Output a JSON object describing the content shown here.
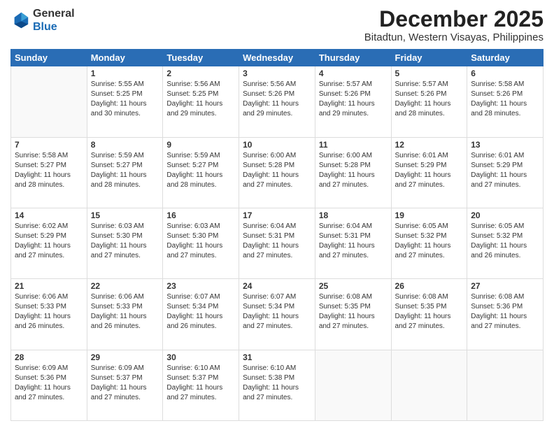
{
  "header": {
    "logo_line1": "General",
    "logo_line2": "Blue",
    "month": "December 2025",
    "location": "Bitadtun, Western Visayas, Philippines"
  },
  "days_of_week": [
    "Sunday",
    "Monday",
    "Tuesday",
    "Wednesday",
    "Thursday",
    "Friday",
    "Saturday"
  ],
  "weeks": [
    [
      {
        "day": "",
        "info": ""
      },
      {
        "day": "1",
        "info": "Sunrise: 5:55 AM\nSunset: 5:25 PM\nDaylight: 11 hours\nand 30 minutes."
      },
      {
        "day": "2",
        "info": "Sunrise: 5:56 AM\nSunset: 5:25 PM\nDaylight: 11 hours\nand 29 minutes."
      },
      {
        "day": "3",
        "info": "Sunrise: 5:56 AM\nSunset: 5:26 PM\nDaylight: 11 hours\nand 29 minutes."
      },
      {
        "day": "4",
        "info": "Sunrise: 5:57 AM\nSunset: 5:26 PM\nDaylight: 11 hours\nand 29 minutes."
      },
      {
        "day": "5",
        "info": "Sunrise: 5:57 AM\nSunset: 5:26 PM\nDaylight: 11 hours\nand 28 minutes."
      },
      {
        "day": "6",
        "info": "Sunrise: 5:58 AM\nSunset: 5:26 PM\nDaylight: 11 hours\nand 28 minutes."
      }
    ],
    [
      {
        "day": "7",
        "info": "Sunrise: 5:58 AM\nSunset: 5:27 PM\nDaylight: 11 hours\nand 28 minutes."
      },
      {
        "day": "8",
        "info": "Sunrise: 5:59 AM\nSunset: 5:27 PM\nDaylight: 11 hours\nand 28 minutes."
      },
      {
        "day": "9",
        "info": "Sunrise: 5:59 AM\nSunset: 5:27 PM\nDaylight: 11 hours\nand 28 minutes."
      },
      {
        "day": "10",
        "info": "Sunrise: 6:00 AM\nSunset: 5:28 PM\nDaylight: 11 hours\nand 27 minutes."
      },
      {
        "day": "11",
        "info": "Sunrise: 6:00 AM\nSunset: 5:28 PM\nDaylight: 11 hours\nand 27 minutes."
      },
      {
        "day": "12",
        "info": "Sunrise: 6:01 AM\nSunset: 5:29 PM\nDaylight: 11 hours\nand 27 minutes."
      },
      {
        "day": "13",
        "info": "Sunrise: 6:01 AM\nSunset: 5:29 PM\nDaylight: 11 hours\nand 27 minutes."
      }
    ],
    [
      {
        "day": "14",
        "info": "Sunrise: 6:02 AM\nSunset: 5:29 PM\nDaylight: 11 hours\nand 27 minutes."
      },
      {
        "day": "15",
        "info": "Sunrise: 6:03 AM\nSunset: 5:30 PM\nDaylight: 11 hours\nand 27 minutes."
      },
      {
        "day": "16",
        "info": "Sunrise: 6:03 AM\nSunset: 5:30 PM\nDaylight: 11 hours\nand 27 minutes."
      },
      {
        "day": "17",
        "info": "Sunrise: 6:04 AM\nSunset: 5:31 PM\nDaylight: 11 hours\nand 27 minutes."
      },
      {
        "day": "18",
        "info": "Sunrise: 6:04 AM\nSunset: 5:31 PM\nDaylight: 11 hours\nand 27 minutes."
      },
      {
        "day": "19",
        "info": "Sunrise: 6:05 AM\nSunset: 5:32 PM\nDaylight: 11 hours\nand 27 minutes."
      },
      {
        "day": "20",
        "info": "Sunrise: 6:05 AM\nSunset: 5:32 PM\nDaylight: 11 hours\nand 26 minutes."
      }
    ],
    [
      {
        "day": "21",
        "info": "Sunrise: 6:06 AM\nSunset: 5:33 PM\nDaylight: 11 hours\nand 26 minutes."
      },
      {
        "day": "22",
        "info": "Sunrise: 6:06 AM\nSunset: 5:33 PM\nDaylight: 11 hours\nand 26 minutes."
      },
      {
        "day": "23",
        "info": "Sunrise: 6:07 AM\nSunset: 5:34 PM\nDaylight: 11 hours\nand 26 minutes."
      },
      {
        "day": "24",
        "info": "Sunrise: 6:07 AM\nSunset: 5:34 PM\nDaylight: 11 hours\nand 27 minutes."
      },
      {
        "day": "25",
        "info": "Sunrise: 6:08 AM\nSunset: 5:35 PM\nDaylight: 11 hours\nand 27 minutes."
      },
      {
        "day": "26",
        "info": "Sunrise: 6:08 AM\nSunset: 5:35 PM\nDaylight: 11 hours\nand 27 minutes."
      },
      {
        "day": "27",
        "info": "Sunrise: 6:08 AM\nSunset: 5:36 PM\nDaylight: 11 hours\nand 27 minutes."
      }
    ],
    [
      {
        "day": "28",
        "info": "Sunrise: 6:09 AM\nSunset: 5:36 PM\nDaylight: 11 hours\nand 27 minutes."
      },
      {
        "day": "29",
        "info": "Sunrise: 6:09 AM\nSunset: 5:37 PM\nDaylight: 11 hours\nand 27 minutes."
      },
      {
        "day": "30",
        "info": "Sunrise: 6:10 AM\nSunset: 5:37 PM\nDaylight: 11 hours\nand 27 minutes."
      },
      {
        "day": "31",
        "info": "Sunrise: 6:10 AM\nSunset: 5:38 PM\nDaylight: 11 hours\nand 27 minutes."
      },
      {
        "day": "",
        "info": ""
      },
      {
        "day": "",
        "info": ""
      },
      {
        "day": "",
        "info": ""
      }
    ]
  ]
}
